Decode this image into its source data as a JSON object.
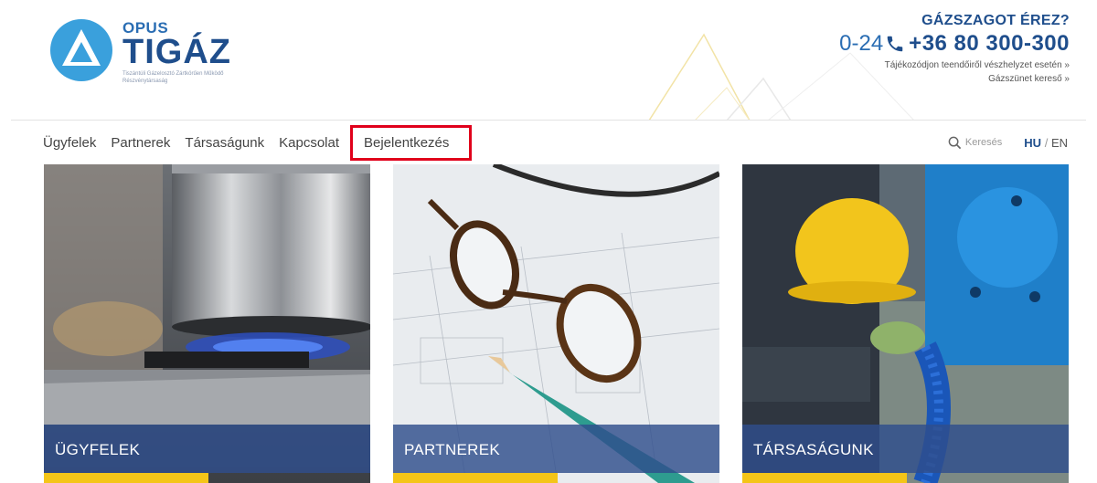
{
  "brand": {
    "opus": "OPUS",
    "tigaz": "TIGÁZ",
    "tagline": "Tiszántúli Gázelosztó Zártkörűen Működő Részvénytársaság"
  },
  "emergency": {
    "title": "GÁZSZAGOT ÉREZ?",
    "phone_prefix": "0-24",
    "phone_number": "+36 80 300-300",
    "info_link": "Tájékozódjon teendőiről vészhelyzet esetén »",
    "outage_link": "Gázszünet kereső »"
  },
  "nav": {
    "items": [
      {
        "label": "Ügyfelek"
      },
      {
        "label": "Partnerek"
      },
      {
        "label": "Társaságunk"
      },
      {
        "label": "Kapcsolat"
      },
      {
        "label": "Bejelentkezés"
      }
    ],
    "search_label": "Keresés",
    "lang_hu": "HU",
    "lang_sep": "/",
    "lang_en": "EN"
  },
  "cards": [
    {
      "title": "ÜGYFELEK"
    },
    {
      "title": "PARTNEREK"
    },
    {
      "title": "TÁRSASÁGUNK"
    }
  ],
  "colors": {
    "brand_blue": "#1f4e8c",
    "accent_yellow": "#f4c518",
    "highlight_red": "#e0001b"
  },
  "icons": {
    "phone": "phone-icon",
    "search": "search-icon"
  }
}
